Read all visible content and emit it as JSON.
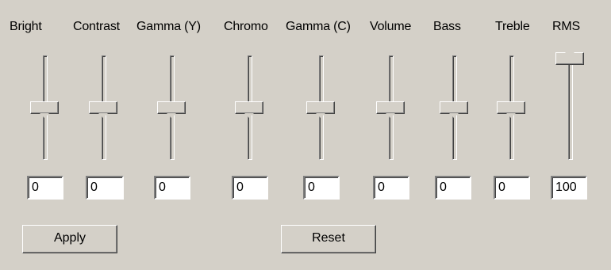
{
  "controls": [
    {
      "label": "Bright",
      "value": "0",
      "position": 0
    },
    {
      "label": "Contrast",
      "value": "0",
      "position": 0
    },
    {
      "label": "Gamma (Y)",
      "value": "0",
      "position": 0
    },
    {
      "label": "Chromo",
      "value": "0",
      "position": 0
    },
    {
      "label": "Gamma (C)",
      "value": "0",
      "position": 0
    },
    {
      "label": "Volume",
      "value": "0",
      "position": 0
    },
    {
      "label": "Bass",
      "value": "0",
      "position": 0
    },
    {
      "label": "Treble",
      "value": "0",
      "position": 0
    },
    {
      "label": "RMS",
      "value": "100",
      "position": 100
    }
  ],
  "buttons": {
    "apply_label": "Apply",
    "reset_label": "Reset"
  },
  "colors": {
    "face": "#d4d0c8",
    "field": "#ffffff"
  }
}
